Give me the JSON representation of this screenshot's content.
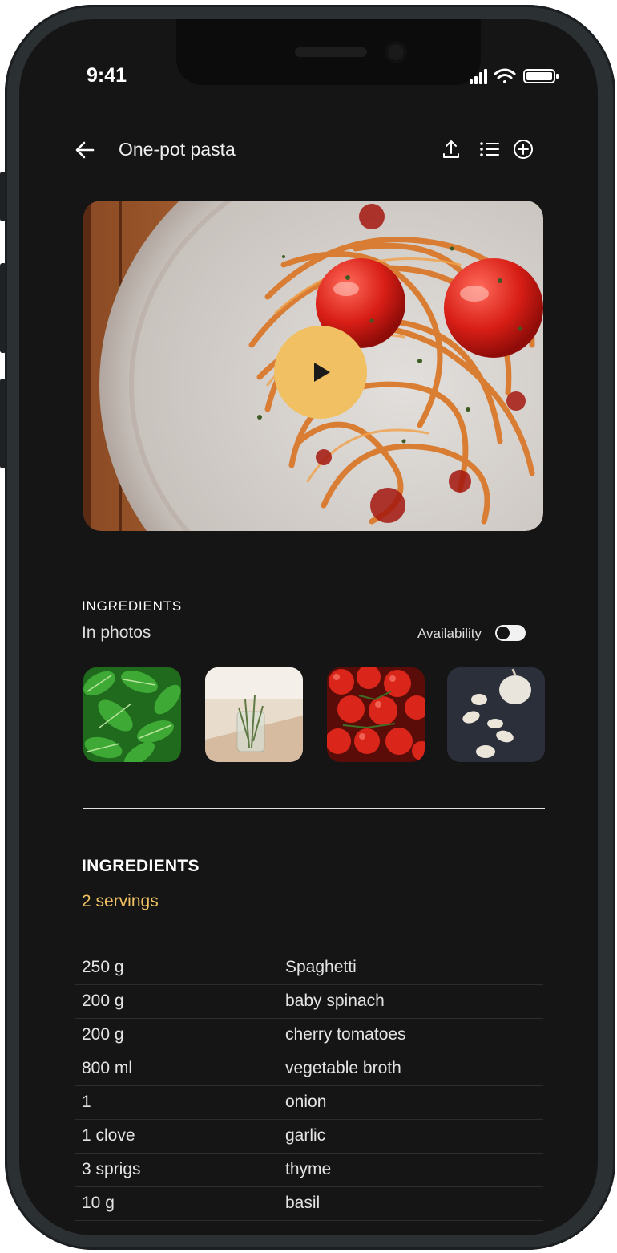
{
  "status_bar": {
    "time": "9:41"
  },
  "header": {
    "title": "One-pot pasta",
    "actions": [
      "share-icon",
      "list-icon",
      "add-icon"
    ]
  },
  "video": {
    "play_icon": "play-icon"
  },
  "ingredients_photos": {
    "section_label": "INGREDIENTS",
    "subtitle": "In photos",
    "availability_label": "Availability",
    "availability_on": true,
    "thumbnails": [
      "spinach-photo",
      "thyme-photo",
      "cherry-tomatoes-photo",
      "garlic-photo"
    ]
  },
  "ingredients": {
    "title": "INGREDIENTS",
    "servings": "2 servings",
    "rows": [
      {
        "qty": "250 g",
        "name": "Spaghetti"
      },
      {
        "qty": "200 g",
        "name": "baby spinach"
      },
      {
        "qty": "200 g",
        "name": "cherry tomatoes"
      },
      {
        "qty": "800 ml",
        "name": "vegetable broth"
      },
      {
        "qty": "1",
        "name": "onion"
      },
      {
        "qty": "1 clove",
        "name": "garlic"
      },
      {
        "qty": "3 sprigs",
        "name": "thyme"
      },
      {
        "qty": "10 g",
        "name": "basil"
      }
    ]
  },
  "colors": {
    "background": "#151515",
    "accent": "#f0c062",
    "text": "#eeeeee"
  }
}
